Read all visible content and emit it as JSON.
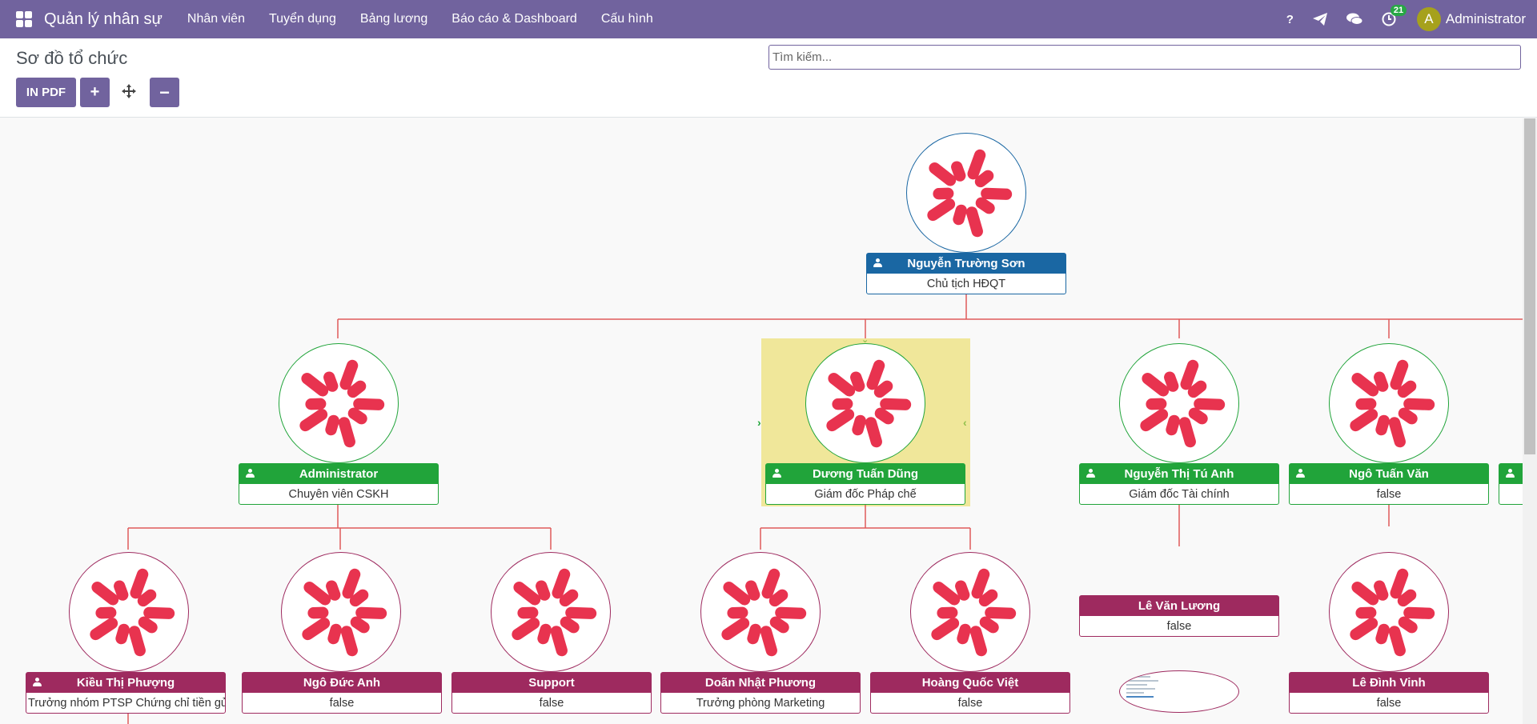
{
  "navbar": {
    "brand": "Quản lý nhân sự",
    "menu": [
      "Nhân viên",
      "Tuyển dụng",
      "Bảng lương",
      "Báo cáo & Dashboard",
      "Cấu hình"
    ],
    "help_label": "?",
    "activity_count": "21",
    "avatar_letter": "A",
    "user_name": "Administrator",
    "color": "#71639e"
  },
  "control_panel": {
    "title": "Sơ đồ tổ chức",
    "print_pdf_label": "IN PDF",
    "zoom_in_label": "+",
    "zoom_out_label": "−",
    "search_placeholder": "Tìm kiếm..."
  },
  "org_chart": {
    "root": {
      "name": "Nguyễn Trường Sơn",
      "title": "Chủ tịch HĐQT"
    },
    "level1": [
      {
        "name": "Administrator",
        "title": "Chuyên viên CSKH"
      },
      {
        "name": "Dương Tuấn Dũng",
        "title": "Giám đốc Pháp chế"
      },
      {
        "name": "Nguyễn Thị Tú Anh",
        "title": "Giám đốc Tài chính"
      },
      {
        "name": "Ngô Tuấn Văn",
        "title": "false"
      }
    ],
    "level2": [
      {
        "name": "Kiều Thị Phượng",
        "title": "Trưởng nhóm PTSP Chứng chỉ tiền gửi"
      },
      {
        "name": "Ngô Đức Anh",
        "title": "false"
      },
      {
        "name": "Support",
        "title": "false"
      },
      {
        "name": "Doãn Nhật Phương",
        "title": "Trưởng phòng Marketing"
      },
      {
        "name": "Hoàng Quốc Việt",
        "title": "false"
      },
      {
        "name": "Lê Văn Lương",
        "title": "false"
      },
      {
        "name": "Lê Đình Vinh",
        "title": "false"
      }
    ],
    "colors": {
      "root": "#1a67a3",
      "manager": "#21a43a",
      "employee": "#9e2a5f",
      "edge": "#e05a5a",
      "selected": "#efe48a"
    }
  }
}
